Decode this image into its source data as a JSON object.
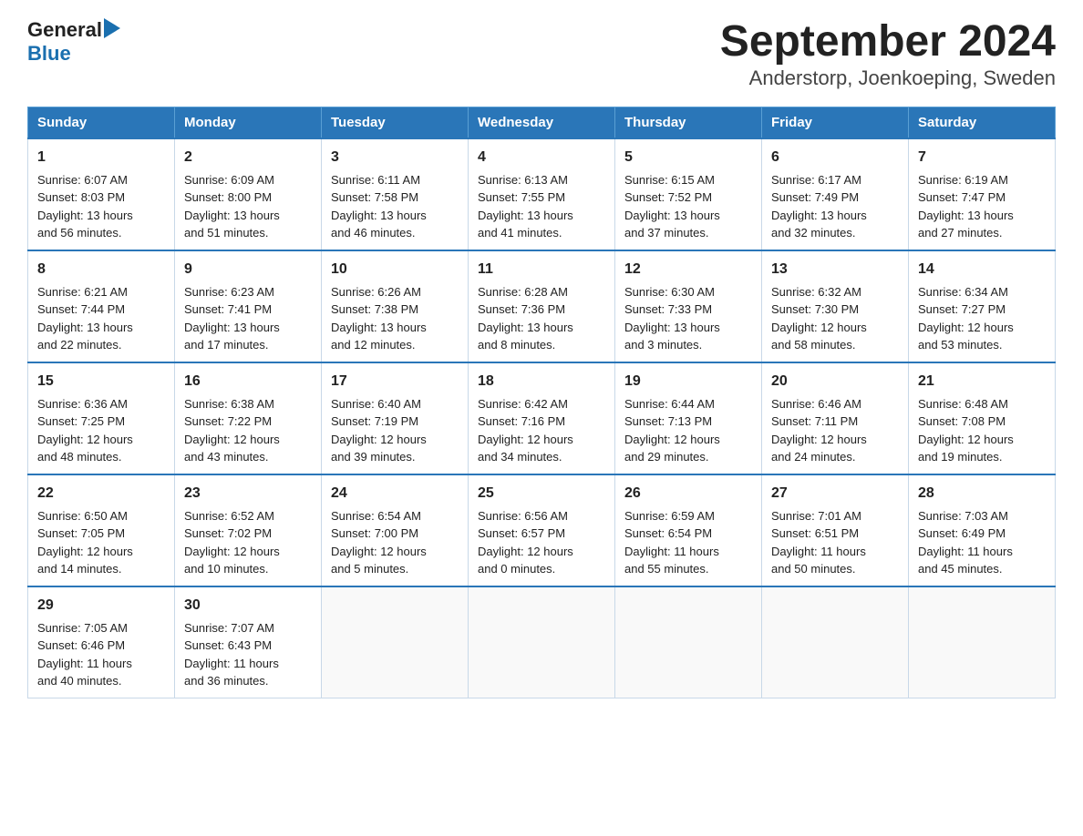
{
  "logo": {
    "general": "General",
    "blue": "Blue"
  },
  "title": "September 2024",
  "subtitle": "Anderstorp, Joenkoeping, Sweden",
  "days_of_week": [
    "Sunday",
    "Monday",
    "Tuesday",
    "Wednesday",
    "Thursday",
    "Friday",
    "Saturday"
  ],
  "weeks": [
    [
      {
        "day": "1",
        "sunrise": "6:07 AM",
        "sunset": "8:03 PM",
        "daylight": "13 hours and 56 minutes."
      },
      {
        "day": "2",
        "sunrise": "6:09 AM",
        "sunset": "8:00 PM",
        "daylight": "13 hours and 51 minutes."
      },
      {
        "day": "3",
        "sunrise": "6:11 AM",
        "sunset": "7:58 PM",
        "daylight": "13 hours and 46 minutes."
      },
      {
        "day": "4",
        "sunrise": "6:13 AM",
        "sunset": "7:55 PM",
        "daylight": "13 hours and 41 minutes."
      },
      {
        "day": "5",
        "sunrise": "6:15 AM",
        "sunset": "7:52 PM",
        "daylight": "13 hours and 37 minutes."
      },
      {
        "day": "6",
        "sunrise": "6:17 AM",
        "sunset": "7:49 PM",
        "daylight": "13 hours and 32 minutes."
      },
      {
        "day": "7",
        "sunrise": "6:19 AM",
        "sunset": "7:47 PM",
        "daylight": "13 hours and 27 minutes."
      }
    ],
    [
      {
        "day": "8",
        "sunrise": "6:21 AM",
        "sunset": "7:44 PM",
        "daylight": "13 hours and 22 minutes."
      },
      {
        "day": "9",
        "sunrise": "6:23 AM",
        "sunset": "7:41 PM",
        "daylight": "13 hours and 17 minutes."
      },
      {
        "day": "10",
        "sunrise": "6:26 AM",
        "sunset": "7:38 PM",
        "daylight": "13 hours and 12 minutes."
      },
      {
        "day": "11",
        "sunrise": "6:28 AM",
        "sunset": "7:36 PM",
        "daylight": "13 hours and 8 minutes."
      },
      {
        "day": "12",
        "sunrise": "6:30 AM",
        "sunset": "7:33 PM",
        "daylight": "13 hours and 3 minutes."
      },
      {
        "day": "13",
        "sunrise": "6:32 AM",
        "sunset": "7:30 PM",
        "daylight": "12 hours and 58 minutes."
      },
      {
        "day": "14",
        "sunrise": "6:34 AM",
        "sunset": "7:27 PM",
        "daylight": "12 hours and 53 minutes."
      }
    ],
    [
      {
        "day": "15",
        "sunrise": "6:36 AM",
        "sunset": "7:25 PM",
        "daylight": "12 hours and 48 minutes."
      },
      {
        "day": "16",
        "sunrise": "6:38 AM",
        "sunset": "7:22 PM",
        "daylight": "12 hours and 43 minutes."
      },
      {
        "day": "17",
        "sunrise": "6:40 AM",
        "sunset": "7:19 PM",
        "daylight": "12 hours and 39 minutes."
      },
      {
        "day": "18",
        "sunrise": "6:42 AM",
        "sunset": "7:16 PM",
        "daylight": "12 hours and 34 minutes."
      },
      {
        "day": "19",
        "sunrise": "6:44 AM",
        "sunset": "7:13 PM",
        "daylight": "12 hours and 29 minutes."
      },
      {
        "day": "20",
        "sunrise": "6:46 AM",
        "sunset": "7:11 PM",
        "daylight": "12 hours and 24 minutes."
      },
      {
        "day": "21",
        "sunrise": "6:48 AM",
        "sunset": "7:08 PM",
        "daylight": "12 hours and 19 minutes."
      }
    ],
    [
      {
        "day": "22",
        "sunrise": "6:50 AM",
        "sunset": "7:05 PM",
        "daylight": "12 hours and 14 minutes."
      },
      {
        "day": "23",
        "sunrise": "6:52 AM",
        "sunset": "7:02 PM",
        "daylight": "12 hours and 10 minutes."
      },
      {
        "day": "24",
        "sunrise": "6:54 AM",
        "sunset": "7:00 PM",
        "daylight": "12 hours and 5 minutes."
      },
      {
        "day": "25",
        "sunrise": "6:56 AM",
        "sunset": "6:57 PM",
        "daylight": "12 hours and 0 minutes."
      },
      {
        "day": "26",
        "sunrise": "6:59 AM",
        "sunset": "6:54 PM",
        "daylight": "11 hours and 55 minutes."
      },
      {
        "day": "27",
        "sunrise": "7:01 AM",
        "sunset": "6:51 PM",
        "daylight": "11 hours and 50 minutes."
      },
      {
        "day": "28",
        "sunrise": "7:03 AM",
        "sunset": "6:49 PM",
        "daylight": "11 hours and 45 minutes."
      }
    ],
    [
      {
        "day": "29",
        "sunrise": "7:05 AM",
        "sunset": "6:46 PM",
        "daylight": "11 hours and 40 minutes."
      },
      {
        "day": "30",
        "sunrise": "7:07 AM",
        "sunset": "6:43 PM",
        "daylight": "11 hours and 36 minutes."
      },
      null,
      null,
      null,
      null,
      null
    ]
  ]
}
